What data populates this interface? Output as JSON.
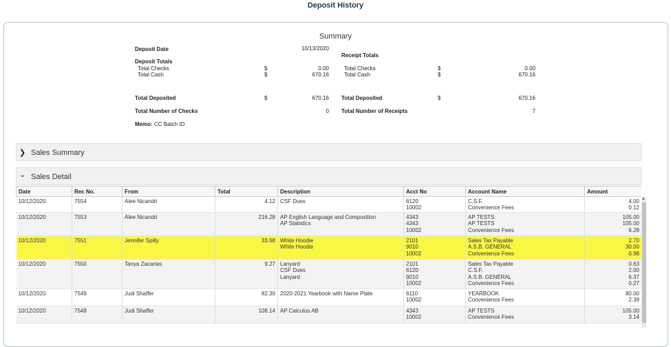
{
  "page_title": "Deposit History",
  "summary": {
    "title": "Summary",
    "deposit_date_label": "Deposit Date",
    "deposit_date": "10/13/2020",
    "deposit_totals_label": "Deposit Totals",
    "receipt_totals_label": "Receipt Totals",
    "total_checks_label": "Total Checks",
    "total_cash_label": "Total Cash",
    "currency": "$",
    "deposit_checks": "0.00",
    "deposit_cash": "670.16",
    "receipt_checks": "0.00",
    "receipt_cash": "670.16",
    "total_deposited_label": "Total Deposited",
    "deposit_total_deposited": "670.16",
    "receipt_total_deposited": "670.16",
    "num_checks_label": "Total Number of Checks",
    "num_checks": "0",
    "num_receipts_label": "Total Number of Receipts",
    "num_receipts": "7",
    "memo_label": "Memo:",
    "memo_value": "CC Batch ID"
  },
  "sections": {
    "sales_summary": {
      "label": "Sales Summary",
      "icon": "chevron-right-icon",
      "glyph": "❯"
    },
    "sales_detail": {
      "label": "Sales Detail",
      "icon": "chevron-down-icon",
      "glyph": "⌄"
    }
  },
  "table": {
    "columns": [
      "Date",
      "Rec No.",
      "From",
      "Total",
      "Description",
      "Acct No",
      "Account Name",
      "Amount"
    ],
    "rows": [
      {
        "date": "10/12/2020",
        "rec": "7554",
        "from": "Alee Nicandri",
        "total": "4.12",
        "desc": [
          "CSF Dues"
        ],
        "acct": [
          "6120",
          "10002"
        ],
        "names": [
          "C.S.F.",
          "Convenience Fees"
        ],
        "amounts": [
          "4.00",
          "0.12"
        ],
        "highlight": false
      },
      {
        "date": "10/12/2020",
        "rec": "7553",
        "from": "Alee Nicandri",
        "total": "216.28",
        "desc": [
          "AP English Language and Composition",
          "AP Statistics"
        ],
        "acct": [
          "4343",
          "4343",
          "10002"
        ],
        "names": [
          "AP TESTS",
          "AP TESTS",
          "Convenience Fees"
        ],
        "amounts": [
          "105.00",
          "105.00",
          "6.28"
        ],
        "highlight": false
      },
      {
        "date": "10/12/2020",
        "rec": "7551",
        "from": "Jennifer Spilly",
        "total": "33.68",
        "desc": [
          "White Hoodie",
          "White Hoodie"
        ],
        "acct": [
          "2101",
          "9010",
          "10002"
        ],
        "names": [
          "Sales Tax Payable",
          "A.S.B. GENERAL",
          "Convenience Fees"
        ],
        "amounts": [
          "2.70",
          "30.00",
          "0.98"
        ],
        "highlight": true
      },
      {
        "date": "10/12/2020",
        "rec": "7550",
        "from": "Tanya Zacarias",
        "total": "9.27",
        "desc": [
          "Lanyard",
          "CSF Dues",
          "Lanyard"
        ],
        "acct": [
          "2101",
          "6120",
          "9010",
          "10002"
        ],
        "names": [
          "Sales Tax Payable",
          "C.S.F.",
          "A.S.B. GENERAL",
          "Convenience Fees"
        ],
        "amounts": [
          "0.63",
          "2.00",
          "6.37",
          "0.27"
        ],
        "highlight": false
      },
      {
        "date": "10/12/2020",
        "rec": "7549",
        "from": "Judi Shaffer",
        "total": "82.39",
        "desc": [
          "2020-2021 Yearbook with Name Plate"
        ],
        "acct": [
          "6110",
          "10002"
        ],
        "names": [
          "YEARBOOK",
          "Convenience Fees"
        ],
        "amounts": [
          "80.00",
          "2.39"
        ],
        "highlight": false
      },
      {
        "date": "10/12/2020",
        "rec": "7548",
        "from": "Judi Shaffer",
        "total": "108.14",
        "desc": [
          "AP Calculus AB"
        ],
        "acct": [
          "4343",
          "10002"
        ],
        "names": [
          "AP TESTS",
          "Convenience Fees"
        ],
        "amounts": [
          "105.00",
          "3.14"
        ],
        "highlight": false
      }
    ]
  },
  "colors": {
    "highlight": "#faf743",
    "title": "#1f3a4d"
  }
}
